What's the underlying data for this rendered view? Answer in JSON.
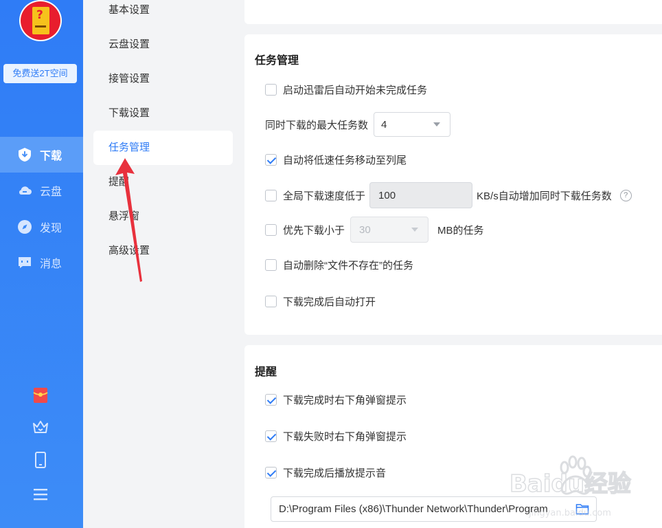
{
  "sidebar": {
    "promo_label": "免费送2T空间",
    "nav": [
      {
        "label": "下载",
        "icon": "download-shield-icon",
        "active": true
      },
      {
        "label": "云盘",
        "icon": "cloud-icon",
        "active": false
      },
      {
        "label": "发现",
        "icon": "compass-icon",
        "active": false
      },
      {
        "label": "消息",
        "icon": "message-icon",
        "active": false
      }
    ],
    "bottom_icons": [
      "red-envelope-icon",
      "crown-icon",
      "phone-icon",
      "menu-icon"
    ]
  },
  "settings_nav": {
    "items": [
      {
        "label": "基本设置",
        "active": false
      },
      {
        "label": "云盘设置",
        "active": false
      },
      {
        "label": "接管设置",
        "active": false
      },
      {
        "label": "下载设置",
        "active": false
      },
      {
        "label": "任务管理",
        "active": true
      },
      {
        "label": "提醒",
        "active": false
      },
      {
        "label": "悬浮窗",
        "active": false
      },
      {
        "label": "高级设置",
        "active": false
      }
    ]
  },
  "task_management": {
    "title": "任务管理",
    "auto_start_label": "启动迅雷后自动开始未完成任务",
    "auto_start_checked": false,
    "max_tasks_label": "同时下载的最大任务数",
    "max_tasks_value": "4",
    "move_slow_label": "自动将低速任务移动至列尾",
    "move_slow_checked": true,
    "speed_prefix": "全局下载速度低于",
    "speed_value": "100",
    "speed_suffix": "KB/s自动增加同时下载任务数",
    "speed_checked": false,
    "help_glyph": "?",
    "priority_prefix": "优先下载小于",
    "priority_value": "30",
    "priority_suffix": "MB的任务",
    "priority_checked": false,
    "auto_delete_label": "自动删除“文件不存在”的任务",
    "auto_delete_checked": false,
    "auto_open_label": "下载完成后自动打开",
    "auto_open_checked": false
  },
  "reminder": {
    "title": "提醒",
    "complete_popup_label": "下载完成时右下角弹窗提示",
    "complete_popup_checked": true,
    "fail_popup_label": "下载失败时右下角弹窗提示",
    "fail_popup_checked": true,
    "sound_label": "下载完成后播放提示音",
    "sound_checked": true,
    "sound_path": "D:\\Program Files (x86)\\Thunder Network\\Thunder\\Program"
  },
  "watermark": {
    "text": "Baidu经验",
    "url": "jingyan.baidu.com"
  },
  "colors": {
    "accent": "#2f7cf6",
    "rail": "#2f7cf6",
    "annotation": "#e8313d"
  }
}
